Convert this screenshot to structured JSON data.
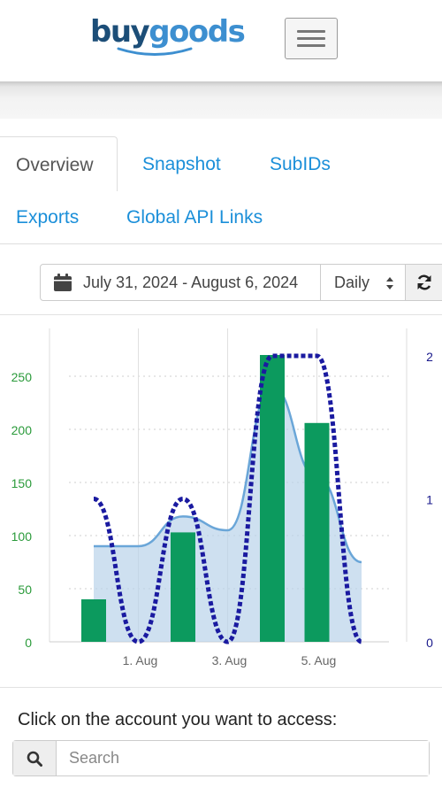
{
  "logo": {
    "part1": "buy",
    "part2": "goods"
  },
  "tabs": [
    {
      "label": "Overview",
      "active": true
    },
    {
      "label": "Snapshot"
    },
    {
      "label": "SubIDs"
    },
    {
      "label": "Exports"
    },
    {
      "label": "Global API Links"
    }
  ],
  "date_range": "July 31, 2024 - August 6, 2024",
  "period_select": "Daily",
  "chart_data": {
    "type": "bar",
    "x_ticks": [
      "1. Aug",
      "3. Aug",
      "5. Aug"
    ],
    "x": [
      "Jul 31",
      "Aug 1",
      "Aug 2",
      "Aug 3",
      "Aug 4",
      "Aug 5",
      "Aug 6"
    ],
    "y_left_ticks": [
      0,
      50,
      100,
      150,
      200,
      250
    ],
    "y_left_range": [
      0,
      270
    ],
    "y_right_ticks": [
      0,
      1,
      2
    ],
    "y_right_range": [
      0,
      2
    ],
    "series": [
      {
        "type": "bar",
        "axis": "left",
        "color": "#0c9a5e",
        "values": [
          40,
          null,
          103,
          null,
          270,
          206,
          null
        ]
      },
      {
        "type": "area",
        "axis": "left",
        "color": "#6aa6d8",
        "values": [
          90,
          90,
          118,
          105,
          240,
          155,
          75
        ]
      },
      {
        "type": "line-dotted",
        "axis": "right",
        "color": "#1a1aa0",
        "values": [
          1,
          0,
          1,
          0,
          2,
          2,
          0
        ]
      }
    ],
    "grid": true,
    "colors": {
      "left_axis": "#2a9a3a",
      "right_axis": "#1a1a8c"
    }
  },
  "account_prompt": "Click on the account you want to access:",
  "search": {
    "placeholder": "Search"
  }
}
